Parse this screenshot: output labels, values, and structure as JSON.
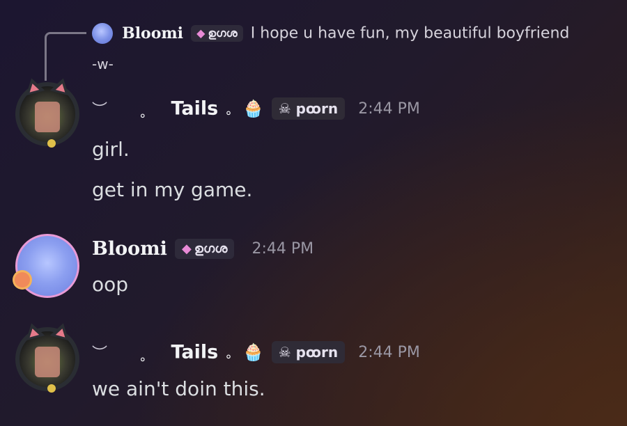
{
  "reply": {
    "author": "Bloomi",
    "author_tag": "ഉഗശ",
    "text": "I hope u have fun, my beautiful boyfriend",
    "text_cont": "-w-"
  },
  "messages": [
    {
      "author": "Tails",
      "prefix": "︶",
      "dot": "∘",
      "dot2": "∘",
      "emoji": "🧁",
      "tag": "pꝏrn",
      "time": "2:44 PM",
      "lines": [
        "girl.",
        "get in my game."
      ]
    },
    {
      "author": "Bloomi",
      "tag": "ഉഗശ",
      "time": "2:44 PM",
      "lines": [
        "oop"
      ]
    },
    {
      "author": "Tails",
      "prefix": "︶",
      "dot": "∘",
      "dot2": "∘",
      "emoji": "🧁",
      "tag": "pꝏrn",
      "time": "2:44 PM",
      "lines": [
        "we ain't doin this."
      ]
    }
  ],
  "icons": {
    "gem": "gem-icon",
    "skull": "skull-icon",
    "cupcake": "cupcake-emoji"
  }
}
